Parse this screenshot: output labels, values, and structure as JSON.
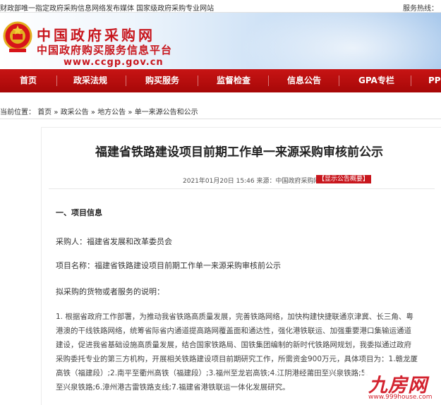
{
  "top_bar": {
    "left_text": "财政部唯一指定政府采购信息网络发布媒体 国家级政府采购专业网站",
    "right_text": "服务热线："
  },
  "header": {
    "site_name": "中国政府采购网",
    "subtitle": "中国政府购买服务信息平台",
    "url": "www.ccgp.gov.cn"
  },
  "nav": {
    "items": [
      {
        "label": "首页"
      },
      {
        "label": "政采法规"
      },
      {
        "label": "购买服务"
      },
      {
        "label": "监督检查"
      },
      {
        "label": "信息公告"
      },
      {
        "label": "GPA专栏"
      },
      {
        "label": "PP"
      }
    ]
  },
  "breadcrumb": {
    "prefix": "当前位置：",
    "items": [
      "首页",
      "政采公告",
      "地方公告",
      "单一来源公告和公示"
    ],
    "separator": "»"
  },
  "article": {
    "title": "福建省铁路建设项目前期工作单一来源采购审核前公示",
    "meta": "2021年01月20日 15:46 来源：中国政府采购网",
    "print_label": "【打印】",
    "summary_label": "【显示公告概要】",
    "section_heading": "一、项目信息",
    "purchaser": "采购人：福建省发展和改革委员会",
    "project_name": "项目名称：福建省铁路建设项目前期工作单一来源采购审核前公示",
    "goods_label": "拟采购的货物或者服务的说明：",
    "details_lines": [
      "1. 根据省政府工作部署，为推动我省铁路高质量发展，完善铁路网络，加快构建快捷联通京津冀、长三角、粤",
      "港澳的干线铁路网络，统筹省际省内通道提高路网覆盖面和通达性，强化港铁联运、加强重要港口集输运通道",
      "建设，促进我省基础设施高质量发展，结合国家铁路局、国铁集团编制的新时代铁路网规划，我委拟通过政府",
      "采购委托专业的第三方机构，开展相关铁路建设项目前期研究工作，所需资金900万元，具体项目为：1.赣龙厦",
      "高铁（福建段）;2.南平至衢州高铁（福建段）;3.福州至龙岩高铁;4.江阴港经莆田至兴泉铁路;5.",
      "至兴泉铁路;6.漳州港古雷铁路支线;7.福建省港铁联运一体化发展研究。"
    ]
  },
  "watermark": {
    "logo_text": "九房网",
    "url": "www.999house.com"
  },
  "colors": {
    "nav_red": "#b60d0d",
    "logo_red": "#c8161d",
    "watermark_red": "#d3232f"
  }
}
